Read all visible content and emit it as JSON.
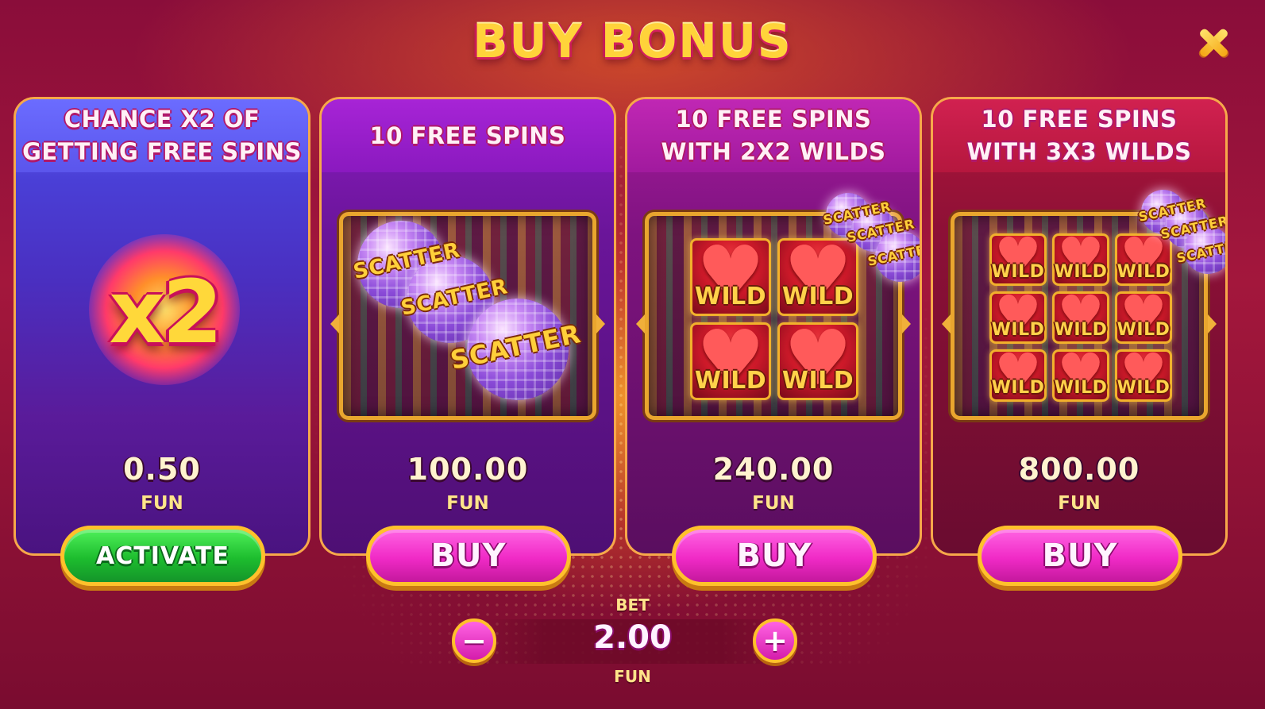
{
  "title": "BUY BONUS",
  "close_icon": "close-icon",
  "cards": [
    {
      "heading_line1": "CHANCE X2 OF",
      "heading_line2": "GETTING FREE SPINS",
      "multiplier": "x2",
      "price": "0.50",
      "currency": "FUN",
      "button": "ACTIVATE"
    },
    {
      "heading_line1": "10 FREE SPINS",
      "heading_line2": "",
      "symbols": [
        "SCATTER",
        "SCATTER",
        "SCATTER"
      ],
      "price": "100.00",
      "currency": "FUN",
      "button": "BUY"
    },
    {
      "heading_line1": "10 FREE SPINS",
      "heading_line2": "WITH 2X2 WILDS",
      "wild_label": "WILD",
      "scatter_label": "SCATTER",
      "price": "240.00",
      "currency": "FUN",
      "button": "BUY"
    },
    {
      "heading_line1": "10 FREE SPINS",
      "heading_line2": "WITH 3X3 WILDS",
      "wild_label": "WILD",
      "scatter_label": "SCATTER",
      "price": "800.00",
      "currency": "FUN",
      "button": "BUY"
    }
  ],
  "bet": {
    "label": "BET",
    "value": "2.00",
    "currency": "FUN",
    "decrease": "−",
    "increase": "+"
  },
  "colors": {
    "title": "#ffd33a",
    "buy_button": "#f02ac6",
    "activate_button": "#1dbd2e",
    "button_border": "#ffc12b"
  }
}
